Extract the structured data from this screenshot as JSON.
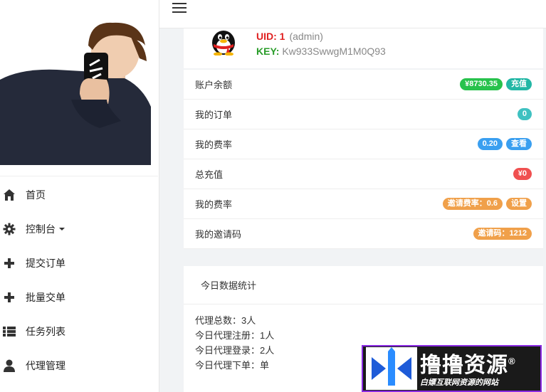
{
  "sidebar": {
    "items": [
      {
        "label": "首页",
        "icon": "home-icon"
      },
      {
        "label": "控制台",
        "icon": "gear-icon"
      },
      {
        "label": "提交订单",
        "icon": "plus-icon"
      },
      {
        "label": "批量交单",
        "icon": "plus-icon"
      },
      {
        "label": "任务列表",
        "icon": "list-icon"
      },
      {
        "label": "代理管理",
        "icon": "user-icon"
      }
    ]
  },
  "topbar": {
    "menu_icon": "hamburger-icon"
  },
  "profile": {
    "uid_label": "UID: 1",
    "role": "(admin)",
    "key_label": "KEY: ",
    "key_value": "Kw933SwwgM1M0Q93"
  },
  "info": {
    "rows": [
      {
        "label": "账户余额",
        "badges": [
          "¥8730.35",
          "充值"
        ]
      },
      {
        "label": "我的订单",
        "badges": [
          "0"
        ]
      },
      {
        "label": "我的费率",
        "badges": [
          "0.20",
          "查看"
        ]
      },
      {
        "label": "总充值",
        "badges": [
          "¥0"
        ]
      },
      {
        "label": "我的费率",
        "badges": [
          "邀请费率：0.6",
          "设置"
        ]
      },
      {
        "label": "我的邀请码",
        "badges": [
          "邀请码：1212"
        ]
      }
    ]
  },
  "stats": {
    "title": "今日数据统计",
    "lines": [
      "代理总数：3人",
      "今日代理注册：1人",
      "今日代理登录：2人",
      "今日代理下单：单"
    ]
  },
  "watermark": {
    "title": "撸撸资源",
    "reg": "®",
    "subtitle": "白嫖互联网资源的网站"
  },
  "colors": {
    "uid": "#e02020",
    "key": "#2a9d2a",
    "badge_green": "#27c24c",
    "badge_teal": "#23b7a5",
    "badge_blue": "#3a9ff0",
    "badge_red": "#f05050",
    "badge_orange": "#f0a04a",
    "watermark_border": "#8a2be2"
  }
}
